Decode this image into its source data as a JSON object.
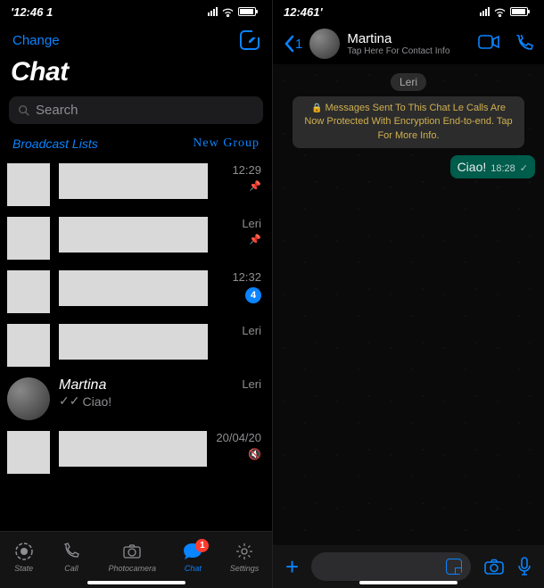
{
  "status": {
    "time_left": "'12:46 1",
    "time_right": "12:461'"
  },
  "left": {
    "nav": {
      "edit": "Change"
    },
    "title": "Chat",
    "search": {
      "placeholder": "Search"
    },
    "listHeader": {
      "broadcast": "Broadcast Lists",
      "newGroup": "New Group"
    },
    "rows": [
      {
        "time": "12:29",
        "pinned": true
      },
      {
        "time": "Leri",
        "pinned": true
      },
      {
        "time": "12:32",
        "unread": "4"
      },
      {
        "time": "Leri"
      },
      {
        "name": "Martina",
        "preview": "Ciao!",
        "time": "Leri",
        "avatar": true
      },
      {
        "time": "20/04/20",
        "muted": true
      }
    ],
    "tabs": {
      "state": "State",
      "call": "Call",
      "camera": "Photocamera",
      "chat": "Chat",
      "chatBadge": "1",
      "settings": "Settings"
    }
  },
  "right": {
    "back": "1",
    "name": "Martina",
    "sub": "Tap Here For Contact Info",
    "date": "Leri",
    "encryption": "Messages Sent To This Chat Le Calls Are Now Protected With Encryption End-to-end. Tap For More Info.",
    "bubble": {
      "text": "Ciao!",
      "time": "18:28"
    }
  }
}
